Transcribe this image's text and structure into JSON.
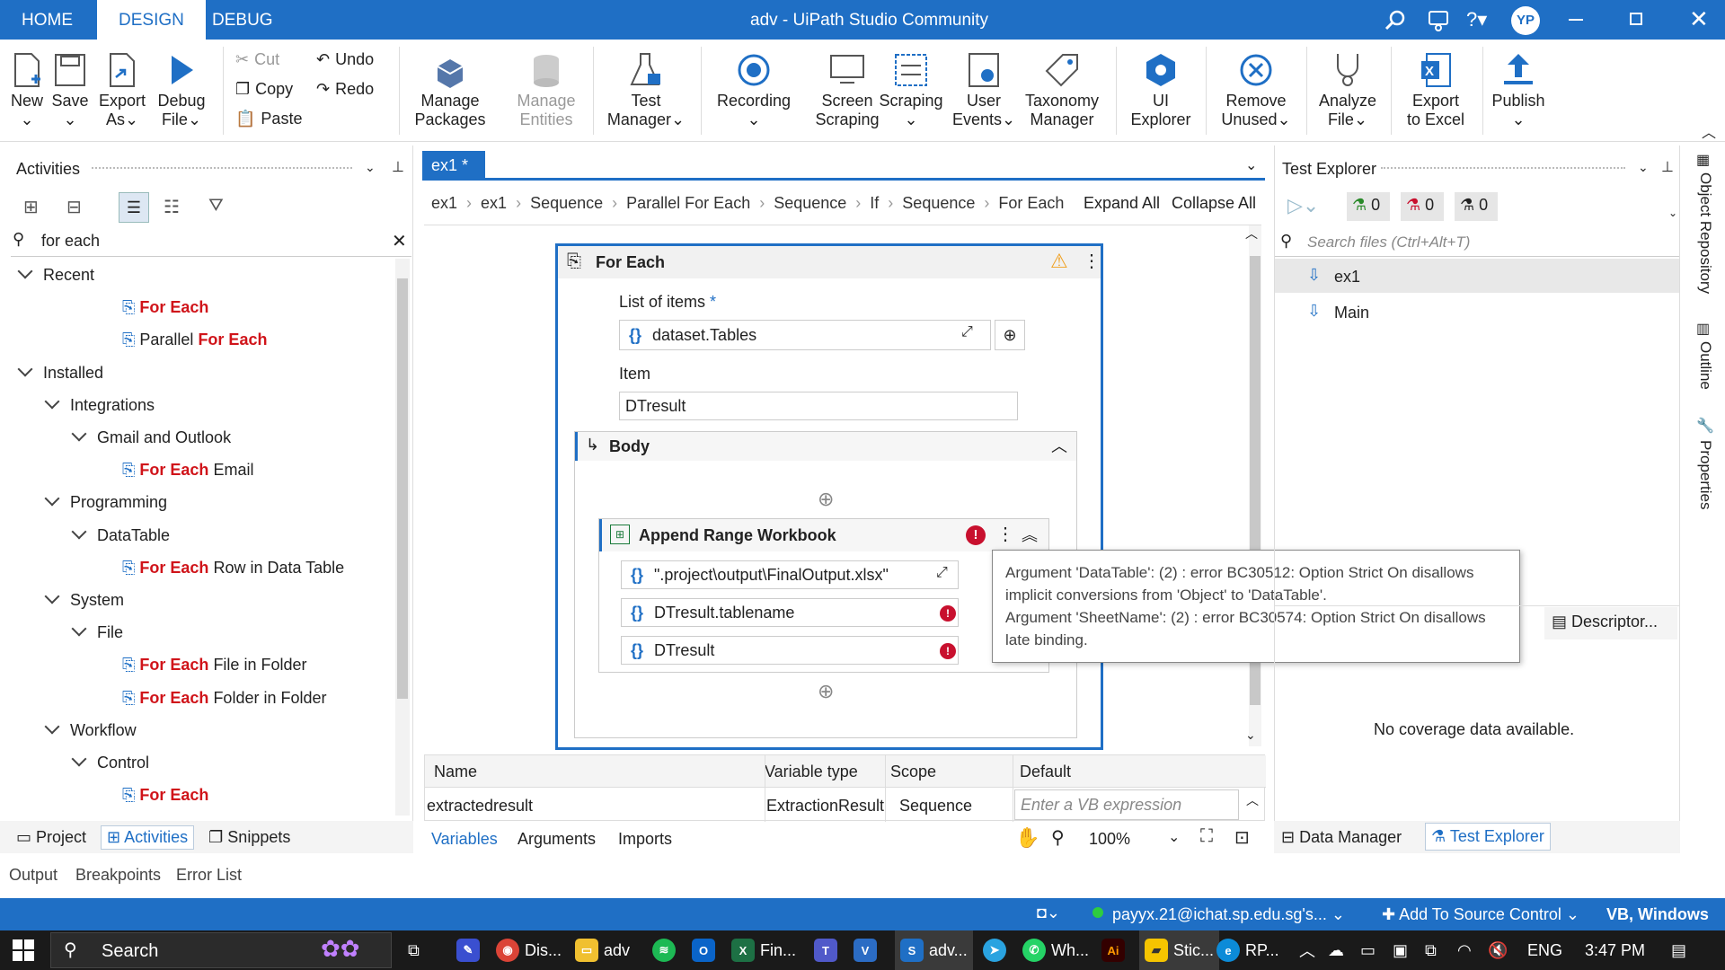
{
  "titlebar": {
    "tabs": [
      "HOME",
      "DESIGN",
      "DEBUG"
    ],
    "title": "adv - UiPath Studio Community",
    "avatar": "YP"
  },
  "ribbon": {
    "new": "New",
    "save": "Save",
    "export_as": "Export",
    "export_as2": "As",
    "debug_file": "Debug",
    "debug_file2": "File",
    "cut": "Cut",
    "copy": "Copy",
    "paste": "Paste",
    "undo": "Undo",
    "redo": "Redo",
    "manage_packages": "Manage",
    "manage_packages2": "Packages",
    "manage_entities": "Manage",
    "manage_entities2": "Entities",
    "test_manager": "Test",
    "test_manager2": "Manager",
    "recording": "Recording",
    "screen_scraping": "Screen",
    "screen_scraping2": "Scraping",
    "scraping": "Scraping",
    "user_events": "User",
    "user_events2": "Events",
    "taxonomy": "Taxonomy",
    "taxonomy2": "Manager",
    "ui_explorer": "UI",
    "ui_explorer2": "Explorer",
    "remove_unused": "Remove",
    "remove_unused2": "Unused",
    "analyze_file": "Analyze",
    "analyze_file2": "File",
    "export_excel": "Export",
    "export_excel2": "to Excel",
    "publish": "Publish"
  },
  "activities": {
    "title": "Activities",
    "search_value": "for each",
    "items": [
      {
        "label": "Recent",
        "level": 0
      },
      {
        "hl": "For Each",
        "rest": "",
        "level": 2
      },
      {
        "pre": "Parallel ",
        "hl": "For Each",
        "rest": "",
        "level": 2
      },
      {
        "label": "Installed",
        "level": 0
      },
      {
        "label": "Integrations",
        "level": 1
      },
      {
        "label": "Gmail and Outlook",
        "level": 2
      },
      {
        "hl": "For Each",
        "rest": " Email",
        "level": 3
      },
      {
        "label": "Programming",
        "level": 1
      },
      {
        "label": "DataTable",
        "level": 2
      },
      {
        "hl": "For Each",
        "rest": " Row in Data Table",
        "level": 3
      },
      {
        "label": "System",
        "level": 1
      },
      {
        "label": "File",
        "level": 2
      },
      {
        "hl": "For Each",
        "rest": " File in Folder",
        "level": 3
      },
      {
        "hl": "For Each",
        "rest": " Folder in Folder",
        "level": 3
      },
      {
        "label": "Workflow",
        "level": 1
      },
      {
        "label": "Control",
        "level": 2
      },
      {
        "hl": "For Each",
        "rest": "",
        "level": 3
      },
      {
        "pre": "Parallel ",
        "hl": "For Each",
        "rest": "",
        "level": 3
      }
    ],
    "bottom_tabs": [
      "Project",
      "Activities",
      "Snippets"
    ]
  },
  "designer": {
    "tab": "ex1 *",
    "breadcrumb": [
      "ex1",
      "ex1",
      "Sequence",
      "Parallel For Each",
      "Sequence",
      "If",
      "Sequence",
      "For Each"
    ],
    "expand_all": "Expand All",
    "collapse_all": "Collapse All",
    "foreach_title": "For Each",
    "list_label": "List of items",
    "required": "*",
    "list_value": "dataset.Tables",
    "item_label": "Item",
    "item_value": "DTresult",
    "body_label": "Body",
    "append_title": "Append Range Workbook",
    "fields": [
      "\".project\\output\\FinalOutput.xlsx\"",
      "DTresult.tablename",
      "DTresult"
    ],
    "tooltip": [
      "Argument 'DataTable': (2) : error BC30512: Option Strict On disallows",
      "implicit conversions from 'Object' to 'DataTable'.",
      "Argument 'SheetName': (2) : error BC30574: Option Strict On disallows",
      "late binding."
    ]
  },
  "variables": {
    "headers": [
      "Name",
      "Variable type",
      "Scope",
      "Default"
    ],
    "row": {
      "name": "extractedresult",
      "type": "ExtractionResult",
      "scope": "Sequence",
      "default_placeholder": "Enter a VB expression"
    },
    "tabs": [
      "Variables",
      "Arguments",
      "Imports"
    ],
    "zoom": "100%"
  },
  "test_explorer": {
    "title": "Test Explorer",
    "counts": [
      "0",
      "0",
      "0"
    ],
    "search_placeholder": "Search files (Ctrl+Alt+T)",
    "files": [
      "ex1",
      "Main"
    ],
    "descriptor": "Descriptor...",
    "no_coverage": "No coverage data available.",
    "bottom_tabs": [
      "Data Manager",
      "Test Explorer"
    ]
  },
  "side_tabs": [
    "Object Repository",
    "Outline",
    "Properties"
  ],
  "output_tabs": [
    "Output",
    "Breakpoints",
    "Error List"
  ],
  "status": {
    "user": "payyx.21@ichat.sp.edu.sg's...",
    "source_control": "Add To Source Control",
    "lang": "VB, Windows"
  },
  "taskbar": {
    "search": "Search",
    "apps": [
      "Dis...",
      "adv",
      "Fin...",
      "adv...",
      "Wh...",
      "Stic...",
      "RP..."
    ],
    "lang": "ENG",
    "time": "3:47 PM"
  },
  "colors": {
    "accent": "#1f6fc5",
    "highlight": "#d0141a",
    "error": "#c8102e",
    "warning": "#f0a020"
  }
}
